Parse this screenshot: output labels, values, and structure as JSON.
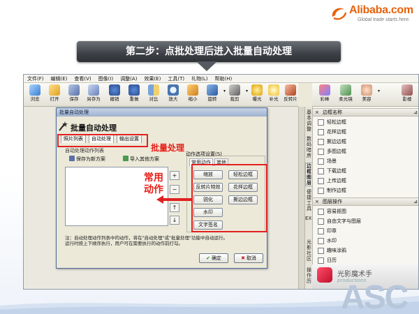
{
  "brand": {
    "name": "Alibaba.com",
    "tagline": "Global trade starts here.",
    "accent": "#e8620c"
  },
  "banner": {
    "title": "第二步：点批处理后进入批量自动处理"
  },
  "menu": [
    "文件(F)",
    "编辑(E)",
    "查看(V)",
    "图像(I)",
    "调整(A)",
    "效果(E)",
    "工具(T)",
    "礼物(L)",
    "帮助(H)"
  ],
  "toolbar": [
    "浏览",
    "打开",
    "保存",
    "另存为",
    "撤销",
    "重做",
    "对比",
    "放大",
    "缩小",
    "旋转",
    "裁剪",
    "曝光",
    "补光",
    "反转片"
  ],
  "right_toolbar": [
    "彩棒",
    "柔光镜",
    "美容",
    "影楼"
  ],
  "side_tabs": [
    "基本调整",
    "数码暗房",
    "边框图层",
    "便捷工具",
    "EXIF",
    "光影社区",
    "操作历"
  ],
  "panel": {
    "border_header": "边框名称",
    "border_items": [
      "轻松边框",
      "花样边框",
      "撕边边框",
      "多图边框",
      "场景",
      "下载边框",
      "上传边框",
      "制作边框"
    ],
    "layer_header": "图层操作",
    "layer_items": [
      "容易抠图",
      "自由文字与图层",
      "印章",
      "水印",
      "趣味涂鸦",
      "日历"
    ]
  },
  "promo": {
    "title": "光影魔术手",
    "subtitle": "productions"
  },
  "dialog": {
    "title": "批量自动处理",
    "heading": "批量自动处理",
    "tabs": [
      "照片列表",
      "自动处理",
      "输出设置"
    ],
    "left_section": "自动处理动作列表",
    "save_scheme": "保存为新方案",
    "import_scheme": "导入其他方案",
    "side_buttons": [
      "+",
      "−",
      "↑",
      "↓"
    ],
    "fieldset_label": "动作选项设置(S)",
    "inner_tabs": [
      "常用动作",
      "其他"
    ],
    "actions": [
      "缩放",
      "轻松边框",
      "反转片特效",
      "花样边框",
      "锐化",
      "撕边边框",
      "水印",
      "文字签名"
    ],
    "note": "注：自动处理动作列表中的动作，将在\"自动处理\"或\"批量处理\"功能中自动运行。\n运行时按上下顺序执行，用户可在需要执行的动作前打勾。",
    "ok": "确定",
    "cancel": "取消"
  },
  "annotations": {
    "batch_label": "批量处理",
    "common_label": "常用动作",
    "red": "#e02020"
  },
  "footer_mark": "ASC"
}
